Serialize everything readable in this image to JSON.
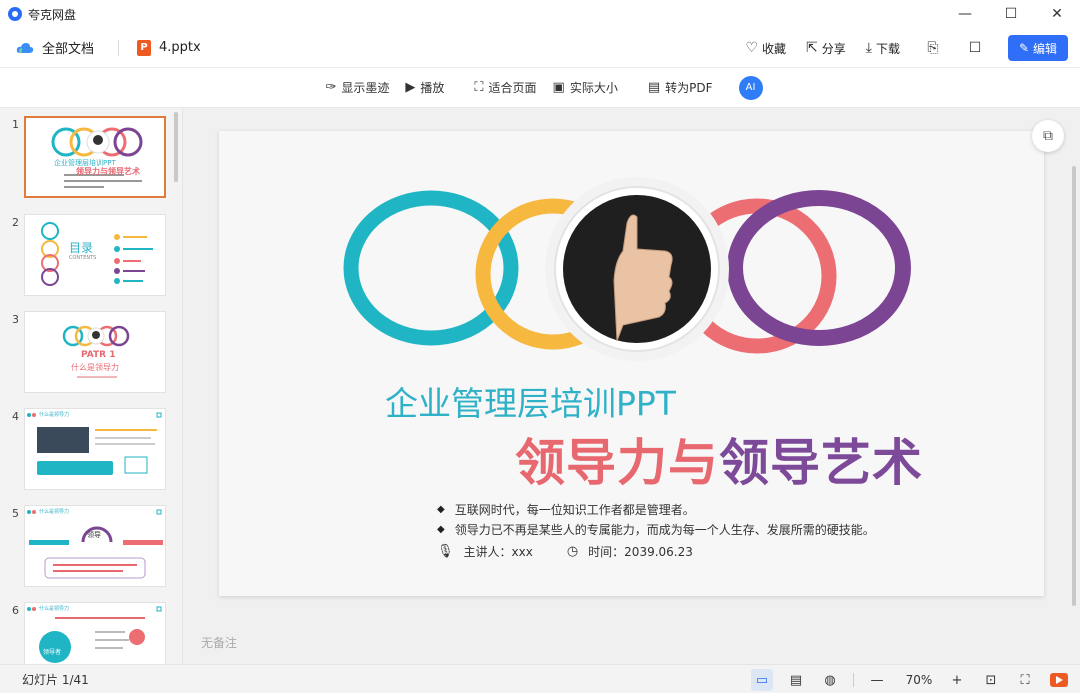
{
  "app": {
    "title": "夸克网盘"
  },
  "window": {
    "minimize": "—",
    "maximize": "☐",
    "close": "✕"
  },
  "nav": {
    "all_docs": "全部文档",
    "file_name": "4.pptx",
    "file_badge": "P",
    "favorite": "收藏",
    "share": "分享",
    "download": "下载",
    "edit": "编辑"
  },
  "toolbar": {
    "ink": "显示墨迹",
    "play": "播放",
    "fit_page": "适合页面",
    "actual_size": "实际大小",
    "to_pdf": "转为PDF",
    "ai": "AI"
  },
  "thumbnails": [
    {
      "num": "1",
      "title": "企业管理层培训PPT",
      "subtitle": "领导力与领导艺术"
    },
    {
      "num": "2",
      "title": "目录",
      "subtitle": "CONTENTS"
    },
    {
      "num": "3",
      "title": "PATR 1",
      "subtitle": "什么是领导力"
    },
    {
      "num": "4",
      "title": "什么是领导力"
    },
    {
      "num": "5",
      "title": "什么是领导力",
      "center": "领导"
    },
    {
      "num": "6",
      "title": "什么是领导力",
      "center": "领导者"
    }
  ],
  "slide": {
    "title_line1": "企业管理层培训PPT",
    "title_line2_part1": "领导力与",
    "title_line2_part2": "领导艺术",
    "bullets": [
      "互联网时代，每一位知识工作者都是管理者。",
      "领导力已不再是某些人的专属能力，而成为每一个人生存、发展所需的硬技能。"
    ],
    "speaker": "主讲人：xxx",
    "time": "时间：2039.06.23",
    "ring_colors": [
      "#1fb5c4",
      "#f6b83f",
      "#ec6e72",
      "#7b4593"
    ]
  },
  "notes_placeholder": "无备注",
  "status": {
    "slide_count": "幻灯片 1/41",
    "zoom": "70%"
  },
  "icons": {
    "cloud": "cloud-icon",
    "heart": "heart-icon",
    "share": "share-icon",
    "download": "download-icon"
  }
}
